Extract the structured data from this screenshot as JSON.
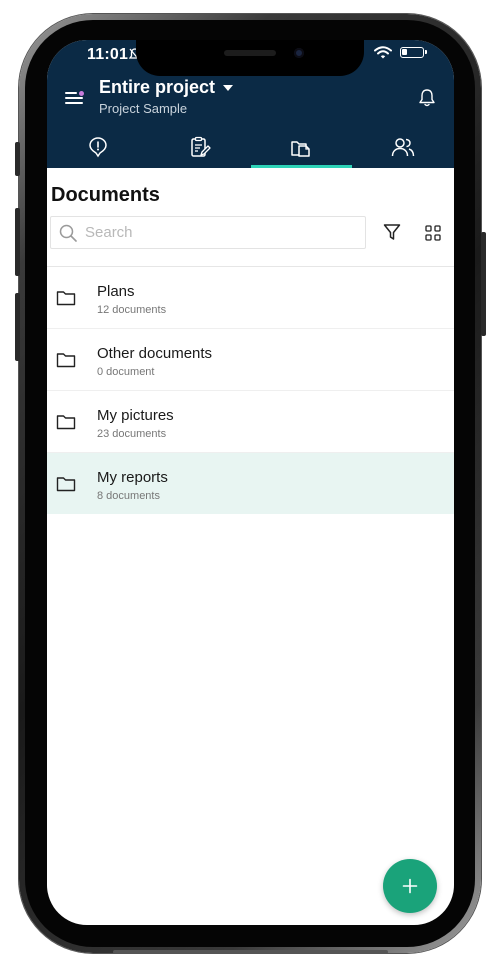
{
  "status": {
    "time": "11:01"
  },
  "header": {
    "project_title": "Entire project",
    "project_subtitle": "Project Sample"
  },
  "tabs": [
    {
      "name": "issues",
      "icon": "alert-circle-icon",
      "active": false
    },
    {
      "name": "reports",
      "icon": "clipboard-edit-icon",
      "active": false
    },
    {
      "name": "documents",
      "icon": "documents-icon",
      "active": true
    },
    {
      "name": "contacts",
      "icon": "users-icon",
      "active": false
    }
  ],
  "page": {
    "title": "Documents",
    "search_placeholder": "Search"
  },
  "folders": [
    {
      "name": "Plans",
      "count": "12 documents",
      "highlight": false
    },
    {
      "name": "Other documents",
      "count": "0 document",
      "highlight": false
    },
    {
      "name": "My pictures",
      "count": "23 documents",
      "highlight": false
    },
    {
      "name": "My reports",
      "count": "8 documents",
      "highlight": true
    }
  ],
  "colors": {
    "header_bg": "#0b2a45",
    "tab_indicator": "#2ed3b7",
    "fab": "#1aa37a",
    "highlight_row": "#e8f5f2"
  }
}
